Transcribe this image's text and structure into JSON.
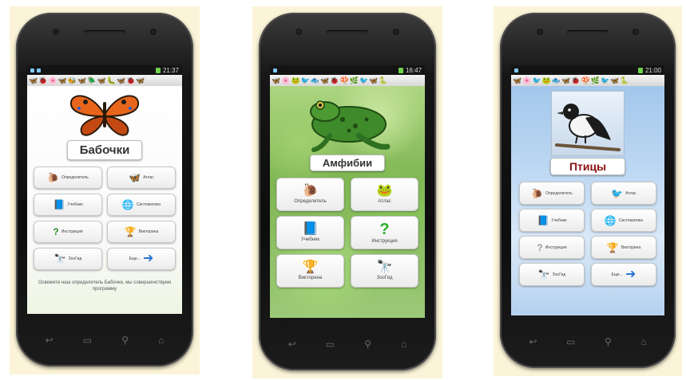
{
  "colors": {
    "panel_bg": "#fbf4d8",
    "phone_body": "#111111",
    "butterfly_orange": "#e8661c",
    "frog_green": "#3f8a2a",
    "bird_title": "#8a1212",
    "arrow_blue": "#2a76d2"
  },
  "phones": [
    {
      "status": {
        "time": "21:37"
      },
      "title": "Бабочки",
      "hero_icon": "butterfly-icon",
      "buttons": [
        {
          "label": "Определитель",
          "icon": "snail-icon"
        },
        {
          "label": "Атлас",
          "icon": "butterfly-icon"
        },
        {
          "label": "Учебник",
          "icon": "book-icon"
        },
        {
          "label": "Систематика",
          "icon": "globe-icon"
        },
        {
          "label": "Инструкция",
          "icon": "question-icon"
        },
        {
          "label": "Викторина",
          "icon": "trophy-icon"
        },
        {
          "label": "ЗооГид",
          "icon": "binoculars-icon"
        },
        {
          "label": "Еще...",
          "icon": "arrow-right-icon"
        }
      ],
      "footnote": "Освежите наш определитель Бабочки, мы совершенствуем программу"
    },
    {
      "status": {
        "time": "16:47"
      },
      "title": "Амфибии",
      "hero_icon": "frog-icon",
      "buttons": [
        {
          "label": "Определитель",
          "icon": "snail-icon"
        },
        {
          "label": "Атлас",
          "icon": "frog-icon"
        },
        {
          "label": "Учебник",
          "icon": "book-icon"
        },
        {
          "label": "Инструкция",
          "icon": "question-icon"
        },
        {
          "label": "Викторина",
          "icon": "trophy-icon"
        },
        {
          "label": "ЗооГид",
          "icon": "binoculars-icon"
        }
      ]
    },
    {
      "status": {
        "time": "21:00"
      },
      "title": "Птицы",
      "hero_icon": "bird-icon",
      "buttons": [
        {
          "label": "Определитель",
          "icon": "snail-icon"
        },
        {
          "label": "Атлас",
          "icon": "bird-icon"
        },
        {
          "label": "Учебник",
          "icon": "book-icon"
        },
        {
          "label": "Систематика",
          "icon": "globe-icon"
        },
        {
          "label": "Инструкция",
          "icon": "question-icon"
        },
        {
          "label": "Викторина",
          "icon": "trophy-icon"
        },
        {
          "label": "ЗооГид",
          "icon": "binoculars-icon"
        },
        {
          "label": "Еще...",
          "icon": "arrow-right-icon"
        }
      ]
    }
  ]
}
